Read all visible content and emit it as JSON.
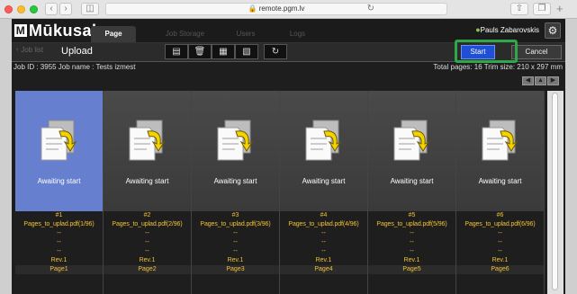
{
  "browser": {
    "url": "remote.pgm.lv",
    "lock_icon": "lock-icon",
    "reload_icon": "reload-icon"
  },
  "app": {
    "logo": "Mūkusala",
    "tabs": [
      "Page",
      "Job Storage",
      "Users",
      "Logs"
    ],
    "active_tab": "Page",
    "user_name": "Pauls Zabarovskis",
    "toolbar": {
      "job_list": "Job list",
      "title": "Upload",
      "start": "Start",
      "cancel": "Cancel"
    },
    "info": {
      "left": "Job ID : 3955   Job name : Tests izmest",
      "right": "Total pages: 16  Trim size: 210 x 297 mm"
    },
    "colors": {
      "selected": "#6680cf",
      "accent_text": "#f2c233",
      "start_button": "#1f4fd4",
      "highlight": "#2fa84a"
    },
    "pages": [
      {
        "status": "Awaiting start",
        "num": "#1",
        "file": "Pages_to_uplad.pdf(1/96)",
        "d1": "--",
        "d2": "--",
        "d3": "--",
        "rev": "Rev.1",
        "page": "Page1",
        "selected": true
      },
      {
        "status": "Awaiting start",
        "num": "#2",
        "file": "Pages_to_uplad.pdf(2/96)",
        "d1": "--",
        "d2": "--",
        "d3": "--",
        "rev": "Rev.1",
        "page": "Page2"
      },
      {
        "status": "Awaiting start",
        "num": "#3",
        "file": "Pages_to_uplad.pdf(3/96)",
        "d1": "--",
        "d2": "--",
        "d3": "--",
        "rev": "Rev.1",
        "page": "Page3"
      },
      {
        "status": "Awaiting start",
        "num": "#4",
        "file": "Pages_to_uplad.pdf(4/96)",
        "d1": "--",
        "d2": "--",
        "d3": "--",
        "rev": "Rev.1",
        "page": "Page4"
      },
      {
        "status": "Awaiting start",
        "num": "#5",
        "file": "Pages_to_uplad.pdf(5/96)",
        "d1": "--",
        "d2": "--",
        "d3": "--",
        "rev": "Rev.1",
        "page": "Page5"
      },
      {
        "status": "Awaiting start",
        "num": "#6",
        "file": "Pages_to_uplad.pdf(6/96)",
        "d1": "--",
        "d2": "--",
        "d3": "--",
        "rev": "Rev.1",
        "page": "Page6"
      }
    ]
  }
}
